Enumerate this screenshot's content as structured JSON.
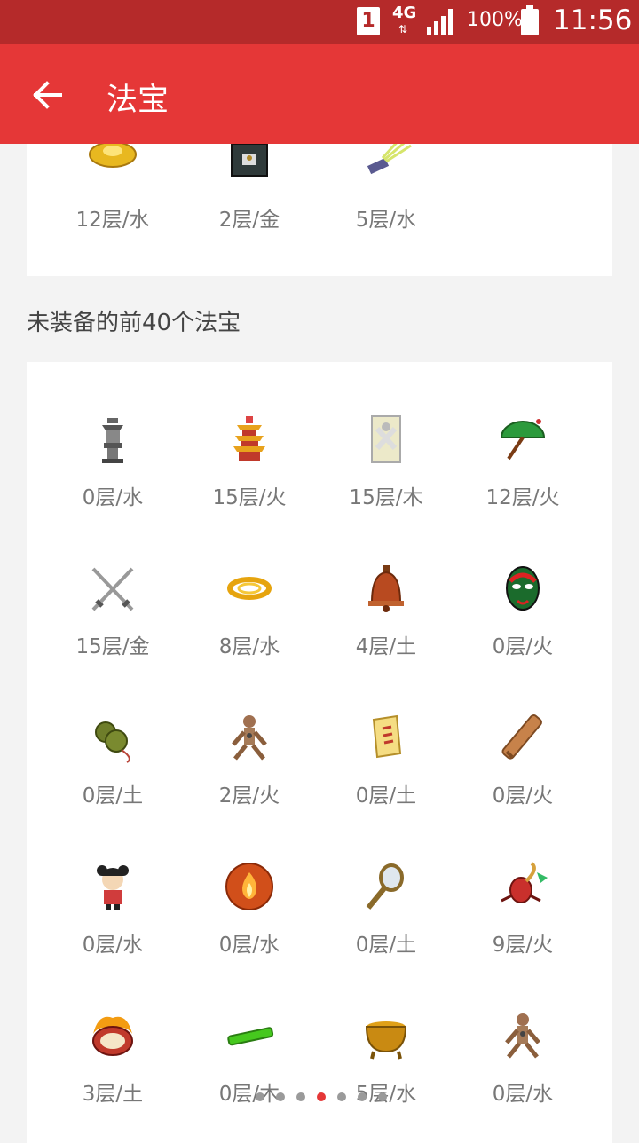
{
  "status_bar": {
    "sim_slot": "1",
    "network": "4G",
    "battery": "100%",
    "time": "11:56"
  },
  "app_bar": {
    "title": "法宝",
    "back_icon": "arrow-left-icon"
  },
  "equipped": {
    "items": [
      {
        "icon": "gold-ingot-icon",
        "label": "12层/水"
      },
      {
        "icon": "treasure-chest-icon",
        "label": "2层/金"
      },
      {
        "icon": "light-beam-icon",
        "label": "5层/水"
      }
    ]
  },
  "section_title": "未装备的前40个法宝",
  "unequipped": {
    "items": [
      {
        "icon": "stone-lantern-icon",
        "label": "0层/水"
      },
      {
        "icon": "pagoda-icon",
        "label": "15层/火"
      },
      {
        "icon": "talisman-icon",
        "label": "15层/木"
      },
      {
        "icon": "green-umbrella-icon",
        "label": "12层/火"
      },
      {
        "icon": "crossed-swords-icon",
        "label": "15层/金"
      },
      {
        "icon": "golden-rope-icon",
        "label": "8层/水"
      },
      {
        "icon": "bronze-bell-icon",
        "label": "4层/土"
      },
      {
        "icon": "opera-mask-icon",
        "label": "0层/火"
      },
      {
        "icon": "gourd-icon",
        "label": "0层/土"
      },
      {
        "icon": "wooden-figure-icon",
        "label": "2层/火"
      },
      {
        "icon": "scroll-icon",
        "label": "0层/土"
      },
      {
        "icon": "bamboo-scroll-icon",
        "label": "0层/火"
      },
      {
        "icon": "doll-icon",
        "label": "0层/水"
      },
      {
        "icon": "fire-orb-icon",
        "label": "0层/水"
      },
      {
        "icon": "hand-mirror-icon",
        "label": "0层/土"
      },
      {
        "icon": "scorpion-icon",
        "label": "9层/火"
      },
      {
        "icon": "flaming-drum-icon",
        "label": "3层/土"
      },
      {
        "icon": "jade-bar-icon",
        "label": "0层/木"
      },
      {
        "icon": "gold-cauldron-icon",
        "label": "5层/水"
      },
      {
        "icon": "wooden-figure-icon",
        "label": "0层/水"
      }
    ]
  },
  "pager": {
    "count": 7,
    "active_index": 3
  },
  "colors": {
    "status_bar": "#b52a2a",
    "app_bar": "#e53737",
    "background": "#f3f3f3",
    "label": "#777777"
  }
}
